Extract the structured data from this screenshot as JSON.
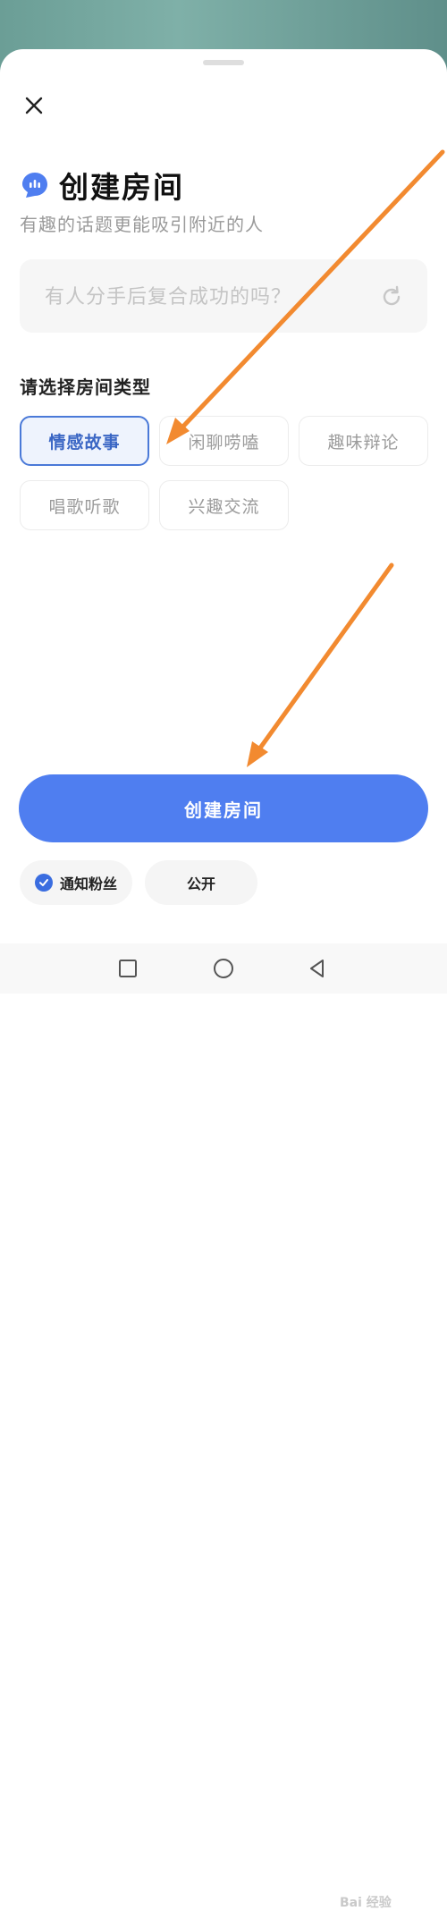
{
  "sheet": {
    "title": "创建房间",
    "subtitle": "有趣的话题更能吸引附近的人",
    "topic_placeholder": "有人分手后复合成功的吗？",
    "section_label": "请选择房间类型",
    "room_types": [
      "情感故事",
      "闲聊唠嗑",
      "趣味辩论",
      "唱歌听歌",
      "兴趣交流"
    ],
    "selected_room_type": "情感故事",
    "create_button": "创建房间",
    "notify_fans_label": "通知粉丝",
    "notify_fans_checked": true,
    "visibility_label": "公开"
  },
  "icons": {
    "close": "close-icon",
    "title": "chat-bubble-icon",
    "refresh": "refresh-icon",
    "check": "check-icon",
    "nav_recent": "square-icon",
    "nav_home": "circle-icon",
    "nav_back": "triangle-back-icon"
  },
  "colors": {
    "accent": "#4f7ef0",
    "chip_active_border": "#4a79d8",
    "annotation_arrow": "#f28a30"
  },
  "watermark": "Bai 经验"
}
